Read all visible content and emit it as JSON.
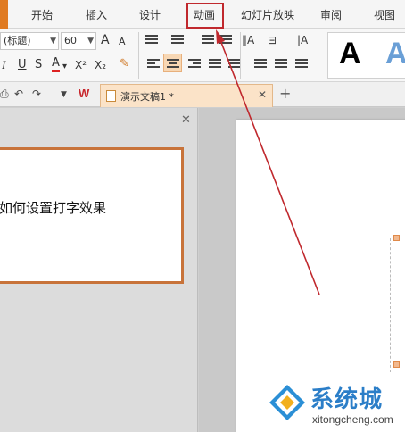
{
  "tabs": [
    "开始",
    "插入",
    "设计",
    "动画",
    "幻灯片放映",
    "审阅",
    "视图"
  ],
  "ribbon": {
    "font_name": "(标题)",
    "font_size": "60",
    "grow_font": "A",
    "shrink_font": "A",
    "italic": "I",
    "underline": "U",
    "strikethrough": "S",
    "font_color": "A",
    "superscript": "X²",
    "subscript": "X₂",
    "style_a1": "A",
    "style_a2": "A",
    "colors": {
      "accent_orange": "#e07b22",
      "highlight_red": "#c0282d",
      "active_tab": "#fbe3c8"
    }
  },
  "document_tab": {
    "title": "演示文稿1 *",
    "wps_logo": "W"
  },
  "slide_thumb": {
    "text": "如何设置打字效果"
  },
  "watermark": {
    "brand": "系统城",
    "url": "xitongcheng.com"
  }
}
